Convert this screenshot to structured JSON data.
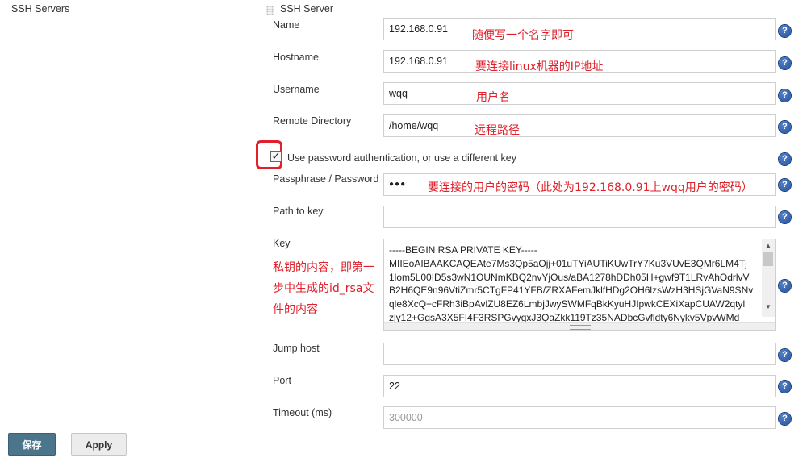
{
  "section": {
    "title": "SSH Servers"
  },
  "server": {
    "title": "SSH Server"
  },
  "fields": {
    "name": {
      "label": "Name",
      "value": "192.168.0.91",
      "annotation": "随便写一个名字即可"
    },
    "hostname": {
      "label": "Hostname",
      "value": "192.168.0.91",
      "annotation": "要连接linux机器的IP地址"
    },
    "username": {
      "label": "Username",
      "value": "wqq",
      "annotation": "用户名"
    },
    "remote_directory": {
      "label": "Remote Directory",
      "value": "/home/wqq",
      "annotation": "远程路径"
    },
    "use_password": {
      "label": "Use password authentication, or use a different key",
      "checked": true,
      "mark": "✓"
    },
    "passphrase": {
      "label": "Passphrase / Password",
      "value": "●●●",
      "annotation": "要连接的用户的密码（此处为192.168.0.91上wqq用户的密码）"
    },
    "path_to_key": {
      "label": "Path to key",
      "value": ""
    },
    "key": {
      "label": "Key",
      "value": "-----BEGIN RSA PRIVATE KEY-----\nMIIEoAIBAAKCAQEAte7Ms3Qp5aOjj+01uTYiAUTiKUwTrY7Ku3VUvE3QMr6LM4Tj\n1lom5L00ID5s3wN1OUNmKBQ2nvYjOus/aBA1278hDDh05H+gwf9T1LRvAhOdrlvV\nB2H6QE9n96VtiZmr5CTgFP41YFB/ZRXAFemJklfHDg2OH6lzsWzH3HSjGVaN9SNv\nqle8XcQ+cFRh3iBpAvlZU8EZ6LmbjJwySWMFqBkKyuHJIpwkCEXiXapCUAW2qtyl\nzjy12+GgsA3X5FI4F3RSPGvygxJ3QaZkk119Tz35NADbcGvfldty6Nykv5VpvWMd",
      "annotation_lines": [
        "私钥的内容，即第一",
        "步中生成的id_rsa文",
        "件的内容"
      ]
    },
    "jump_host": {
      "label": "Jump host",
      "value": ""
    },
    "port": {
      "label": "Port",
      "value": "22"
    },
    "timeout": {
      "label": "Timeout (ms)",
      "value": "300000"
    }
  },
  "help_glyph": "?",
  "scroll": {
    "up": "▲",
    "down": "▼"
  },
  "buttons": {
    "save": "保存",
    "apply": "Apply"
  },
  "colors": {
    "annotation_red": "#e0202a",
    "save_button": "#4b758b",
    "help_icon": "#2a5aa8"
  }
}
